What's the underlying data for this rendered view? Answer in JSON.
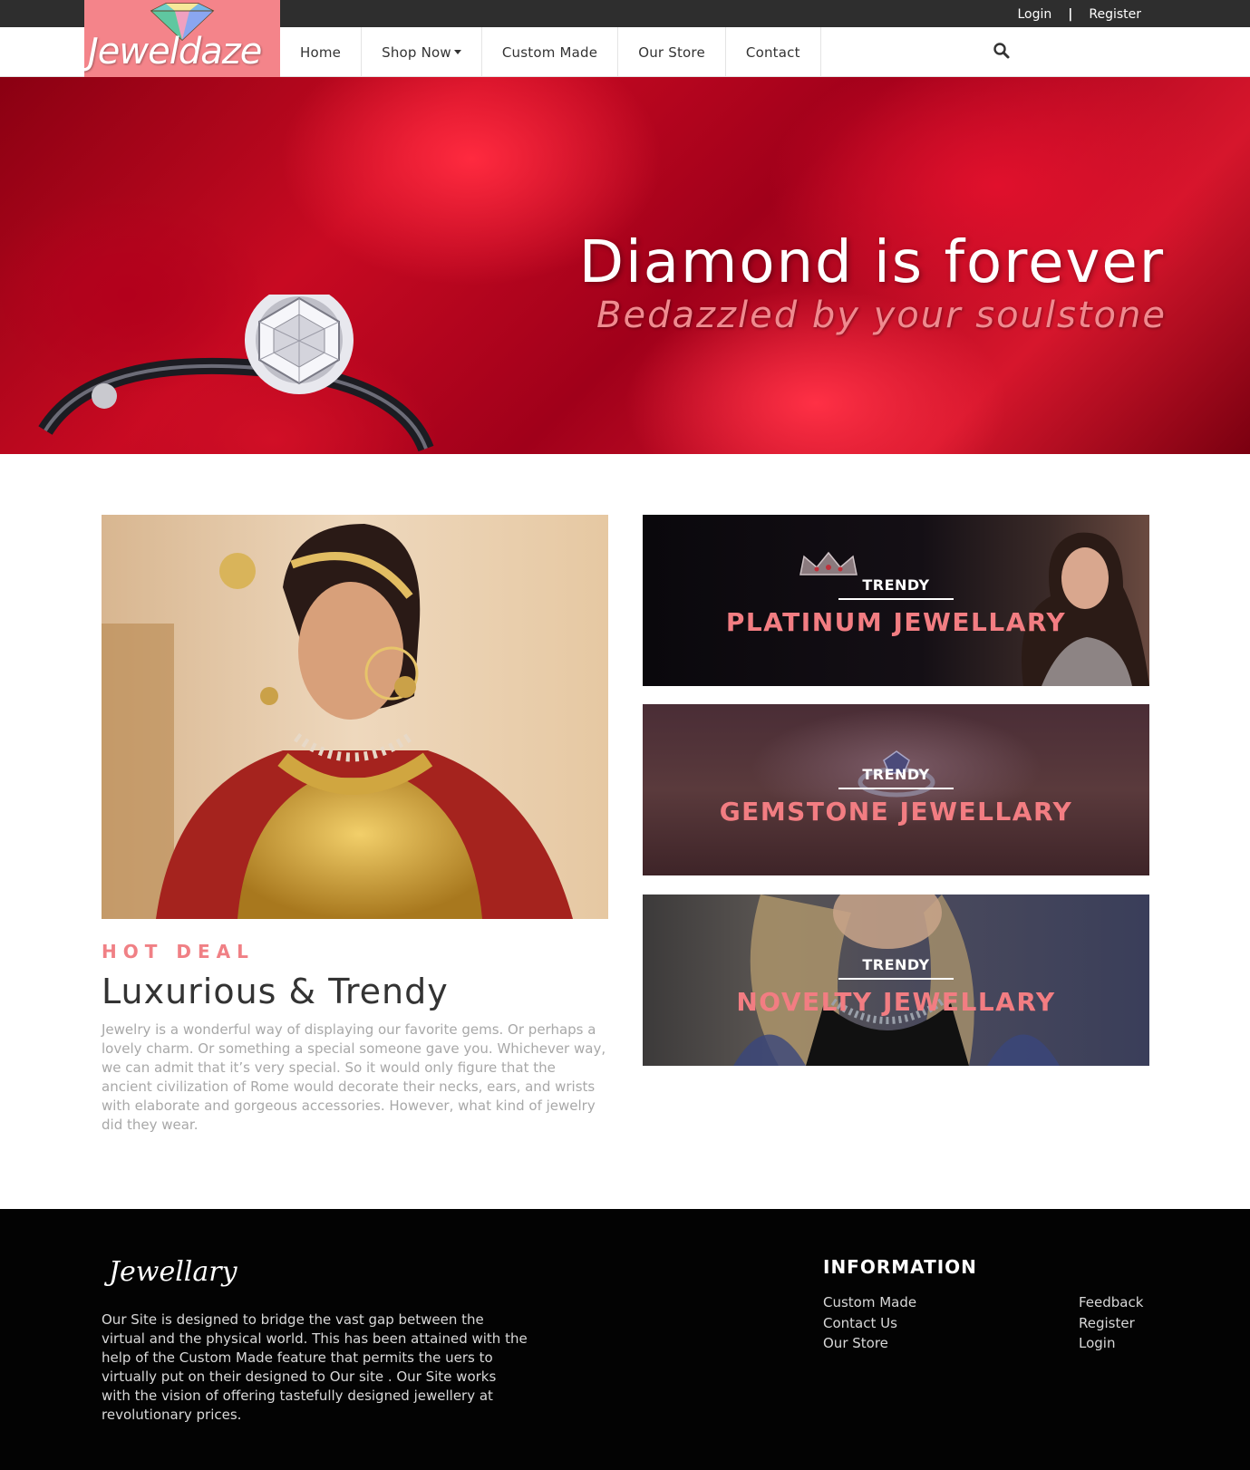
{
  "topbar": {
    "login": "Login",
    "separator": "|",
    "register": "Register"
  },
  "brand": {
    "name": "Jeweldaze",
    "logo_bg": "#f4848a"
  },
  "nav": {
    "items": [
      "Home",
      "Shop Now",
      "Custom Made",
      "Our Store",
      "Contact"
    ],
    "search_icon": "search-icon"
  },
  "hero": {
    "title": "Diamond is forever",
    "subtitle": "Bedazzled by your soulstone"
  },
  "feature": {
    "eyebrow": "HOT DEAL",
    "title": "Luxurious & Trendy",
    "body": "Jewelry is a wonderful way of displaying our favorite gems. Or perhaps a lovely charm. Or something a special someone gave you. Whichever way, we can admit that it’s very special. So it would only figure that the ancient civilization of Rome would decorate their necks, ears, and wrists with elaborate and gorgeous accessories. However, what kind of jewelry did they wear."
  },
  "cards": [
    {
      "eyebrow": "TRENDY",
      "title": "PLATINUM JEWELLARY"
    },
    {
      "eyebrow": "TRENDY",
      "title": "GEMSTONE JEWELLARY"
    },
    {
      "eyebrow": "TRENDY",
      "title": "NOVELTY JEWELLARY"
    }
  ],
  "footer": {
    "script_title": "Jewellary",
    "about": "Our Site is designed to bridge the vast gap between the virtual and the physical world. This has been attained with the help of the Custom Made feature that permits the uers to virtually put on their designed to Our site . Our Site works with the vision of offering tastefully designed jewellery at revolutionary prices.",
    "info_title": "INFORMATION",
    "links_left": [
      "Custom Made",
      "Contact Us",
      "Our Store"
    ],
    "links_right": [
      "Feedback",
      "Register",
      "Login"
    ]
  },
  "colors": {
    "accent": "#f27d82",
    "topbar": "#2e2e2e",
    "footer": "#030303"
  }
}
